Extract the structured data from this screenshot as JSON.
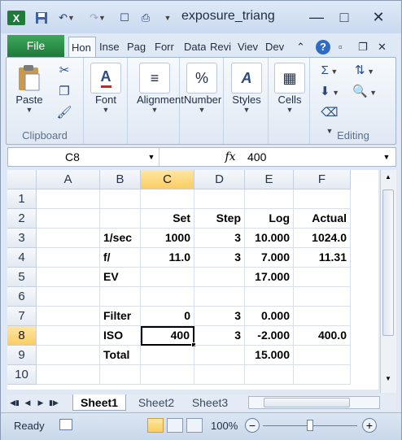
{
  "window": {
    "title": "exposure_triang",
    "minimize": "—",
    "maximize": "□",
    "close": "✕"
  },
  "tabs": [
    {
      "label": "File"
    },
    {
      "label": "Hon"
    },
    {
      "label": "Inse"
    },
    {
      "label": "Pag"
    },
    {
      "label": "Forr"
    },
    {
      "label": "Data"
    },
    {
      "label": "Revi"
    },
    {
      "label": "Viev"
    },
    {
      "label": "Dev"
    }
  ],
  "ribbon": {
    "paste": "Paste",
    "clipboard": "Clipboard",
    "font": "Font",
    "alignment": "Alignment",
    "number": "Number",
    "styles": "Styles",
    "cells": "Cells",
    "editing": "Editing",
    "number_glyph": "%",
    "sum_glyph": "Σ"
  },
  "formula_bar": {
    "name_box": "C8",
    "fx": "fx",
    "value": "400"
  },
  "columns": [
    "A",
    "B",
    "C",
    "D",
    "E",
    "F"
  ],
  "rows": [
    "1",
    "2",
    "3",
    "4",
    "5",
    "6",
    "7",
    "8",
    "9",
    "10"
  ],
  "cells": {
    "C2": "Set",
    "D2": "Step",
    "E2": "Log",
    "F2": "Actual",
    "B3": "1/sec",
    "C3": "1000",
    "D3": "3",
    "E3": "10.000",
    "F3": "1024.0",
    "B4": "f/",
    "C4": "11.0",
    "D4": "3",
    "E4": "7.000",
    "F4": "11.31",
    "B5": "EV",
    "E5": "17.000",
    "B7": "Filter",
    "C7": "0",
    "D7": "3",
    "E7": "0.000",
    "B8": "ISO",
    "C8": "400",
    "D8": "3",
    "E8": "-2.000",
    "F8": "400.0",
    "B9": "Total",
    "E9": "15.000"
  },
  "sheets": [
    "Sheet1",
    "Sheet2",
    "Sheet3"
  ],
  "status": {
    "ready": "Ready",
    "zoom": "100%",
    "zoom_out": "−",
    "zoom_in": "+"
  }
}
